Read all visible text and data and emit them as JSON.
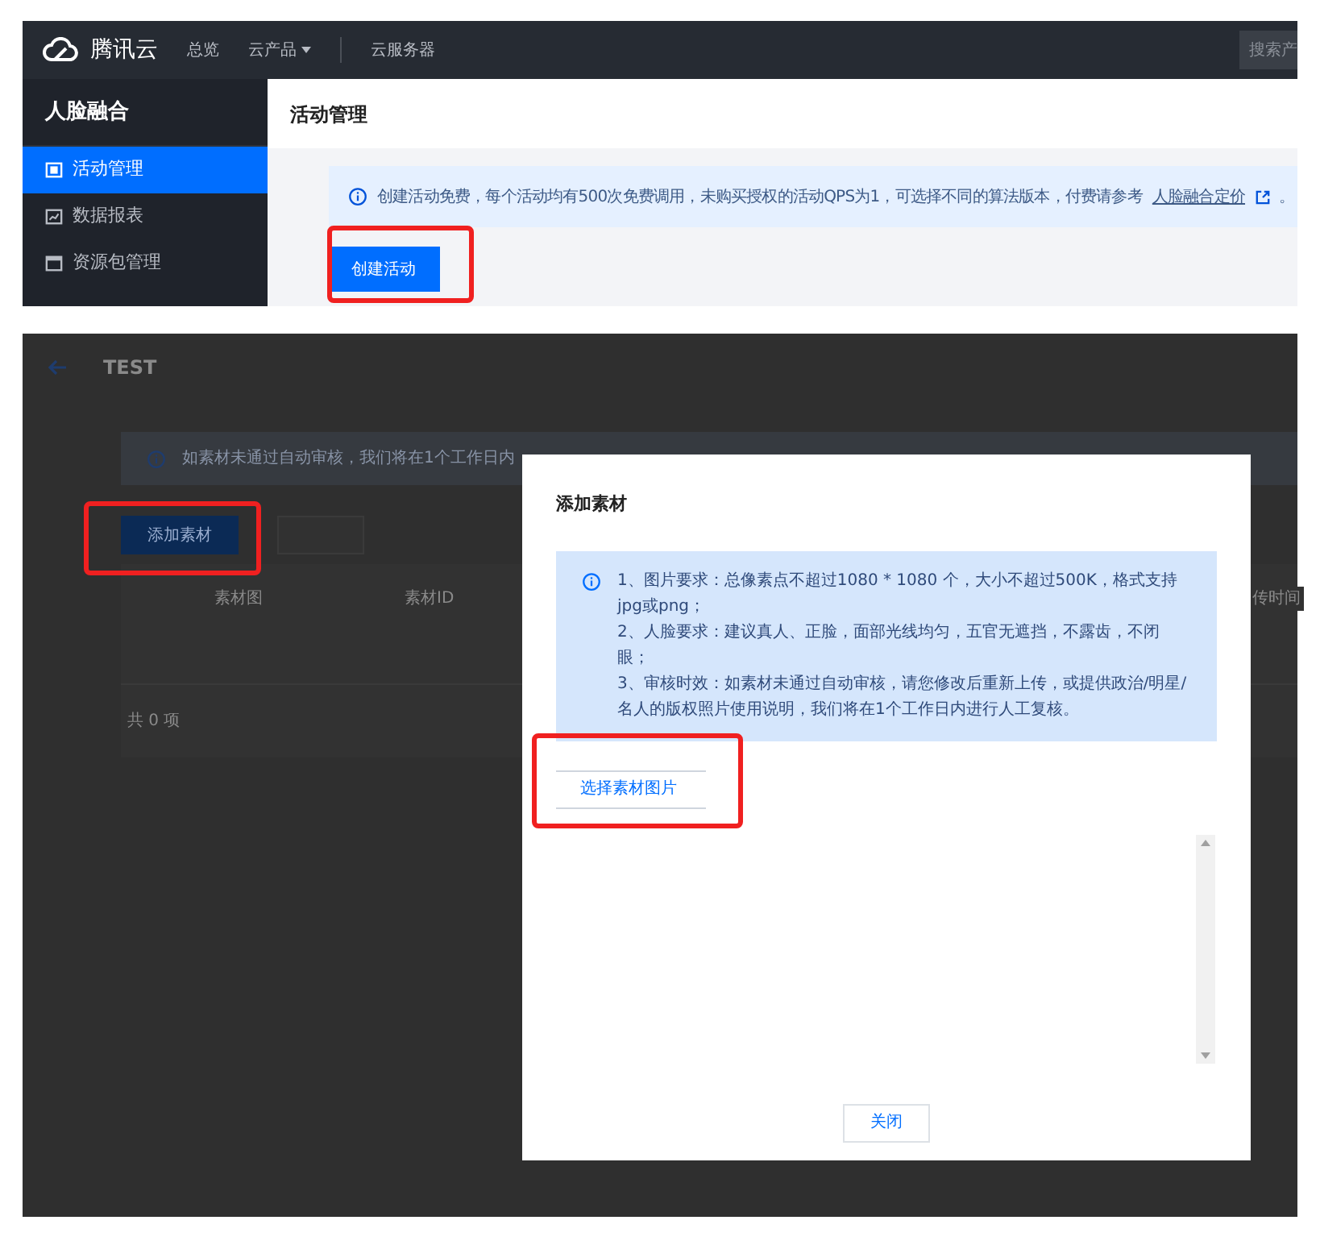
{
  "console": {
    "brand": "腾讯云",
    "nav": [
      {
        "label": "总览",
        "dropdown": false
      },
      {
        "label": "云产品",
        "dropdown": true
      },
      {
        "label": "云服务器",
        "dropdown": false
      }
    ],
    "search": {
      "placeholder": "搜索产"
    },
    "sidebar": {
      "title": "人脸融合",
      "items": [
        {
          "label": "活动管理",
          "selected": true
        },
        {
          "label": "数据报表",
          "selected": false
        },
        {
          "label": "资源包管理",
          "selected": false
        }
      ]
    },
    "page_title": "活动管理",
    "notice": {
      "text": "创建活动免费，每个活动均有500次免费调用，未购买授权的活动QPS为1，可选择不同的算法版本，付费请参考",
      "link": "人脸融合定价",
      "end": "。"
    },
    "create_button": "创建活动"
  },
  "detail": {
    "title": "TEST",
    "notice": "如素材未通过自动审核，我们将在1个工作日内",
    "add_button": "添加素材",
    "columns": [
      "素材图",
      "素材ID",
      "传时间"
    ],
    "footer": "共 0 项"
  },
  "dialog": {
    "title": "添加素材",
    "tips": [
      "1、图片要求：总像素点不超过1080 * 1080 个，大小不超过500K，格式支持jpg或png；",
      "2、人脸要求：建议真人、正脸，面部光线均匀，五官无遮挡，不露齿，不闭眼；",
      "3、审核时效：如素材未通过自动审核，请您修改后重新上传，或提供政治/明星/名人的版权照片使用说明，我们将在1个工作日内进行人工复核。"
    ],
    "select_button": "选择素材图片",
    "close_button": "关闭"
  }
}
